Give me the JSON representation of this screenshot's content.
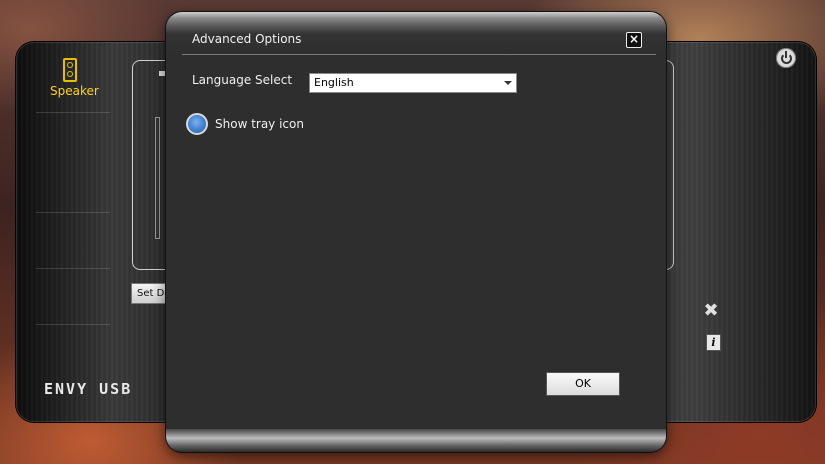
{
  "app": {
    "sidebar": {
      "active_item": {
        "label": "Speaker",
        "icon": "speaker-icon",
        "accent": "#ffd21a"
      }
    },
    "set_default_label": "Set De",
    "brand": "ENVY USB",
    "icons": {
      "power": "power-icon",
      "tools": "tools-icon",
      "info": "info-icon"
    },
    "info_glyph": "i"
  },
  "dialog": {
    "title": "Advanced Options",
    "close_glyph": "×",
    "language": {
      "label": "Language Select",
      "selected": "English"
    },
    "tray": {
      "label": "Show tray icon",
      "checked": true,
      "color": "#3f7fd0"
    },
    "ok_label": "OK"
  }
}
